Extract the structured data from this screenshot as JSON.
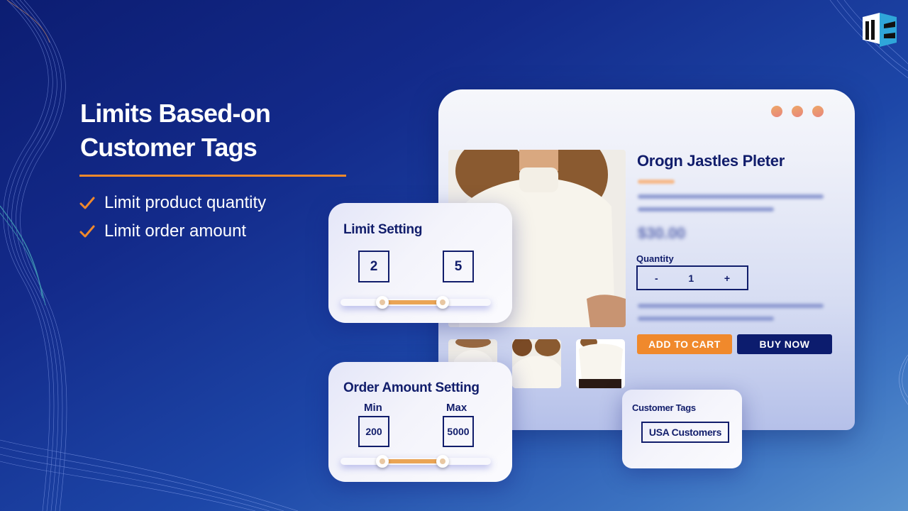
{
  "hero": {
    "title_line1": "Limits Based-on",
    "title_line2": "Customer Tags",
    "features": [
      {
        "icon": "check-icon",
        "label": "Limit product quantity"
      },
      {
        "icon": "check-icon",
        "label": "Limit order amount"
      }
    ]
  },
  "brand": {
    "logo": "mc-cube-logo"
  },
  "colors": {
    "accent_orange": "#f0892c",
    "navy": "#111d6b",
    "button_navy": "#0c1c6e",
    "window_dot": "#e8957a",
    "bg_dark": "#0c1d72",
    "bg_light": "#5a93cf"
  },
  "product": {
    "title": "Orogn Jastles Pleter",
    "price": "$30.00",
    "quantity_label": "Quantity",
    "quantity_value": "1",
    "decrement": "-",
    "increment": "+",
    "add_to_cart": "ADD TO CART",
    "buy_now": "BUY NOW"
  },
  "limit_setting": {
    "title": "Limit Setting",
    "min": "2",
    "max": "5",
    "slider_range_fraction": [
      0.28,
      0.68
    ]
  },
  "order_amount_setting": {
    "title": "Order Amount Setting",
    "min_label": "Min",
    "max_label": "Max",
    "min": "200",
    "max": "5000",
    "slider_range_fraction": [
      0.28,
      0.68
    ]
  },
  "customer_tags": {
    "title": "Customer Tags",
    "tag": "USA Customers"
  }
}
